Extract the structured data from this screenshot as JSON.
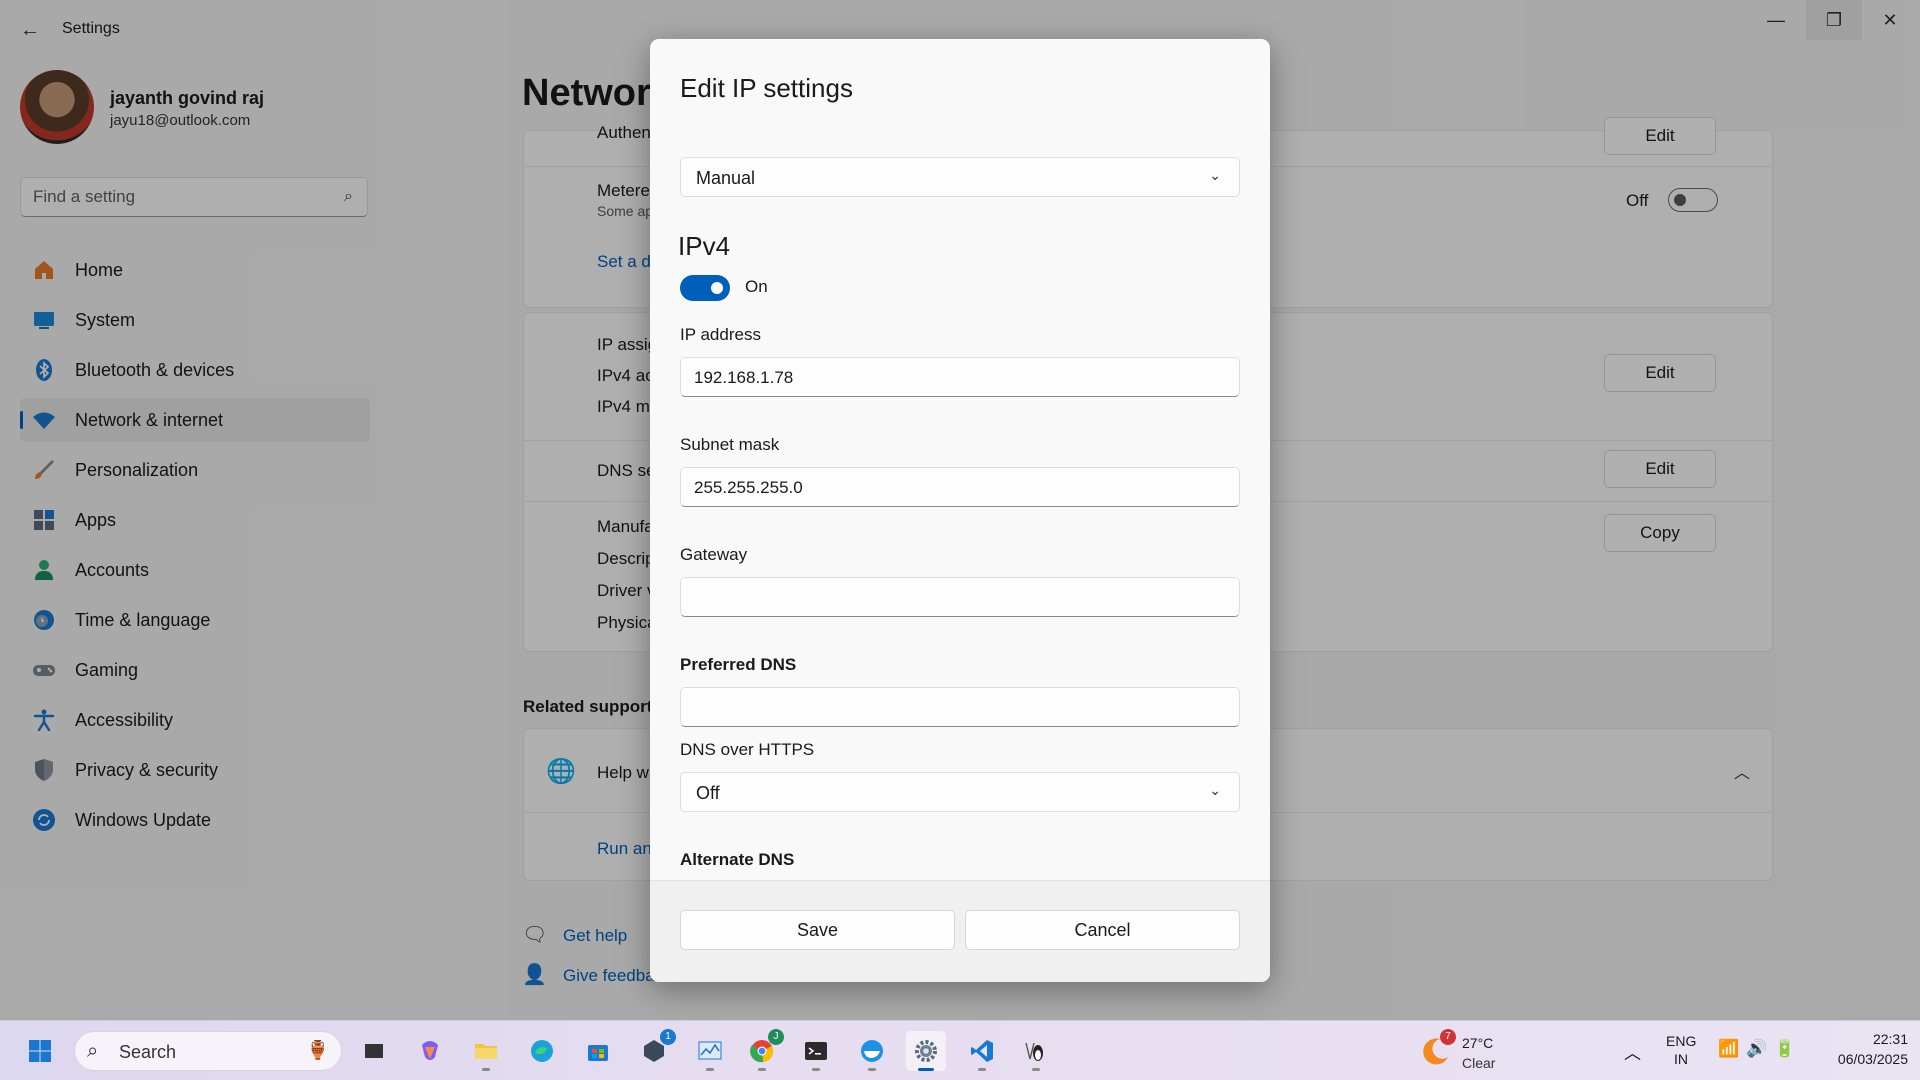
{
  "window": {
    "title": "Settings",
    "controls": {
      "minimize": "—",
      "maximize": "❐",
      "close": "✕"
    }
  },
  "profile": {
    "name": "jayanth govind raj",
    "email": "jayu18@outlook.com"
  },
  "search": {
    "placeholder": "Find a setting"
  },
  "sidebar": {
    "items": [
      {
        "label": "Home",
        "icon": "home-icon",
        "active": false
      },
      {
        "label": "System",
        "icon": "system-icon",
        "active": false
      },
      {
        "label": "Bluetooth & devices",
        "icon": "bluetooth-icon",
        "active": false
      },
      {
        "label": "Network & internet",
        "icon": "wifi-icon",
        "active": true
      },
      {
        "label": "Personalization",
        "icon": "brush-icon",
        "active": false
      },
      {
        "label": "Apps",
        "icon": "apps-icon",
        "active": false
      },
      {
        "label": "Accounts",
        "icon": "person-icon",
        "active": false
      },
      {
        "label": "Time & language",
        "icon": "clock-globe-icon",
        "active": false
      },
      {
        "label": "Gaming",
        "icon": "gamepad-icon",
        "active": false
      },
      {
        "label": "Accessibility",
        "icon": "accessibility-icon",
        "active": false
      },
      {
        "label": "Privacy & security",
        "icon": "shield-icon",
        "active": false
      },
      {
        "label": "Windows Update",
        "icon": "update-icon",
        "active": false
      }
    ]
  },
  "main": {
    "title": "Network",
    "rows": {
      "authentication": "Authen",
      "metered": "Metere",
      "metered_sub": "Some ap",
      "set_data_link": "Set a d",
      "metered_state": "Off",
      "ip_assignment": "IP assig",
      "ipv4_address": "IPv4 ac",
      "ipv4_mask": "IPv4 m",
      "dns_server": "DNS se",
      "manufacturer": "Manufa",
      "description": "Descrip",
      "driver": "Driver v",
      "physical": "Physica"
    },
    "buttons": {
      "edit1": "Edit",
      "edit2": "Edit",
      "edit3": "Edit",
      "copy": "Copy"
    },
    "related_support": "Related support",
    "help_row": "Help w",
    "run_link": "Run an",
    "get_help": "Get help",
    "give_feedback": "Give feedback"
  },
  "dialog": {
    "title": "Edit IP settings",
    "mode": "Manual",
    "ipv4_heading": "IPv4",
    "ipv4_toggle_label": "On",
    "ip_address_label": "IP address",
    "ip_address_value": "192.168.1.78",
    "subnet_label": "Subnet mask",
    "subnet_value": "255.255.255.0",
    "gateway_label": "Gateway",
    "gateway_value": "",
    "preferred_dns_label": "Preferred DNS",
    "preferred_dns_value": "",
    "doh_label": "DNS over HTTPS",
    "doh_value": "Off",
    "alternate_dns_label": "Alternate DNS",
    "save": "Save",
    "cancel": "Cancel"
  },
  "taskbar": {
    "search_label": "Search",
    "weather": {
      "badge": "7",
      "temp": "27°C",
      "condition": "Clear"
    },
    "language": {
      "line1": "ENG",
      "line2": "IN"
    },
    "clock": {
      "time": "22:31",
      "date": "06/03/2025"
    },
    "badges": {
      "whatsapp": "1",
      "chrome": "J"
    }
  },
  "colors": {
    "accent": "#005fb8",
    "link": "#005fb8"
  }
}
